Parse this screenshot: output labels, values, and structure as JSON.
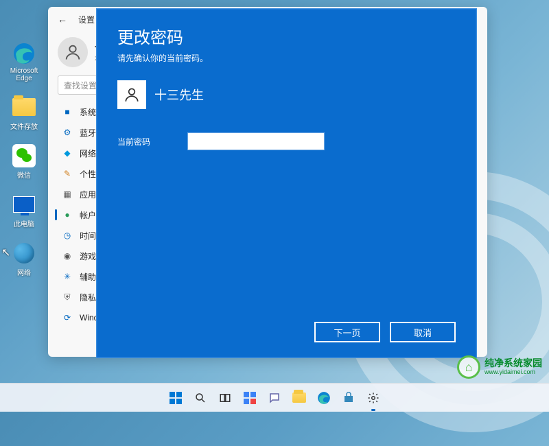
{
  "desktop": {
    "icons": [
      {
        "name": "edge",
        "label": "Microsoft\nEdge"
      },
      {
        "name": "folder",
        "label": "文件存放"
      },
      {
        "name": "wechat",
        "label": "微信"
      },
      {
        "name": "thispc",
        "label": "此电脑"
      },
      {
        "name": "network",
        "label": "网络"
      }
    ]
  },
  "settings": {
    "title": "设置",
    "profile": {
      "name": "十",
      "sub": "本"
    },
    "search_placeholder": "查找设置",
    "nav": [
      {
        "icon": "■",
        "cls": "i-system",
        "label": "系统"
      },
      {
        "icon": "⚙",
        "cls": "i-bt",
        "label": "蓝牙和"
      },
      {
        "icon": "◆",
        "cls": "i-net",
        "label": "网络 &"
      },
      {
        "icon": "✎",
        "cls": "i-pers",
        "label": "个性化"
      },
      {
        "icon": "▦",
        "cls": "i-apps",
        "label": "应用"
      },
      {
        "icon": "●",
        "cls": "i-acct",
        "label": "帐户",
        "active": true
      },
      {
        "icon": "◷",
        "cls": "i-time",
        "label": "时间和"
      },
      {
        "icon": "◉",
        "cls": "i-game",
        "label": "游戏"
      },
      {
        "icon": "✳",
        "cls": "i-access",
        "label": "辅助功"
      },
      {
        "icon": "⛨",
        "cls": "i-priv",
        "label": "隐私和"
      },
      {
        "icon": "⟳",
        "cls": "i-update",
        "label": "Windo"
      }
    ]
  },
  "modal": {
    "title": "更改密码",
    "subtitle": "请先确认你的当前密码。",
    "username": "十三先生",
    "password_label": "当前密码",
    "password_value": "",
    "btn_next": "下一页",
    "btn_cancel": "取消"
  },
  "watermark": {
    "line1": "纯净系统家园",
    "line2": "www.yidaimei.com"
  }
}
